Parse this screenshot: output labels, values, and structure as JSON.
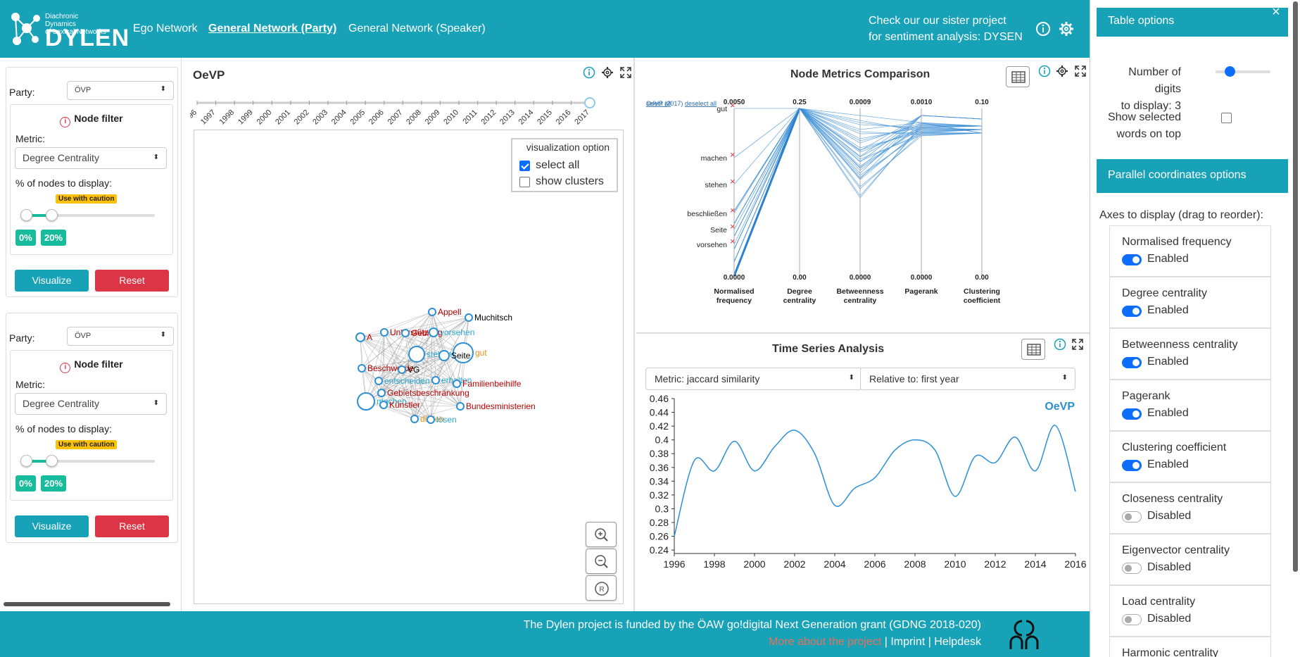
{
  "header": {
    "logo_subtitle_1": "Diachronic Dynamics",
    "logo_subtitle_2": "of Lexical Networks",
    "logo_text": "DYLEN",
    "nav": [
      "Ego Network",
      "General Network (Party)",
      "General Network (Speaker)"
    ],
    "nav_active": "General Network (Party)",
    "sister_line1": "Check our our sister project",
    "sister_line2": "for sentiment analysis: DYSEN",
    "icons": [
      "info-icon",
      "gear-icon"
    ]
  },
  "left_panels": [
    {
      "party_label": "Party:",
      "party_value": "ÖVP",
      "node_filter_title": "Node filter",
      "metric_label": "Metric:",
      "metric_value": "Degree Centrality",
      "percent_label": "% of nodes to display:",
      "caution": "Use with caution",
      "range_min": "0%",
      "range_max": "20%",
      "visualize": "Visualize",
      "reset": "Reset"
    },
    {
      "party_label": "Party:",
      "party_value": "ÖVP",
      "node_filter_title": "Node filter",
      "metric_label": "Metric:",
      "metric_value": "Degree Centrality",
      "percent_label": "% of nodes to display:",
      "caution": "Use with caution",
      "range_min": "0%",
      "range_max": "20%",
      "visualize": "Visualize",
      "reset": "Reset"
    }
  ],
  "network": {
    "title": "OeVP",
    "years": [
      "1996",
      "1997",
      "1998",
      "1999",
      "2000",
      "2001",
      "2002",
      "2003",
      "2004",
      "2005",
      "2006",
      "2007",
      "2008",
      "2009",
      "2010",
      "2011",
      "2012",
      "2013",
      "2014",
      "2015",
      "2016",
      "2017"
    ],
    "selected_year": "2017",
    "vis_option_title": "visualization option",
    "select_all": "select all",
    "show_clusters": "show clusters",
    "select_all_checked": true,
    "show_clusters_checked": false,
    "node_labels": [
      {
        "text": "Appell",
        "color": "#b00"
      },
      {
        "text": "Muchitsch",
        "color": "#000"
      },
      {
        "text": "A",
        "color": "#b00"
      },
      {
        "text": "Unterstützung",
        "color": "#b00"
      },
      {
        "text": "Gebiet",
        "color": "#b00"
      },
      {
        "text": "vorsehen",
        "color": "#29a8d0"
      },
      {
        "text": "gut",
        "color": "#e8901a"
      },
      {
        "text": "Beschwerde",
        "color": "#b00"
      },
      {
        "text": "VG",
        "color": "#000"
      },
      {
        "text": "stehen",
        "color": "#29a8d0"
      },
      {
        "text": "entscheiden",
        "color": "#29a8d0"
      },
      {
        "text": "Seite",
        "color": "#000"
      },
      {
        "text": "erhalten",
        "color": "#29a8d0"
      },
      {
        "text": "Familienbeihilfe",
        "color": "#b00"
      },
      {
        "text": "Gebietsbeschränkung",
        "color": "#b00"
      },
      {
        "text": "machen",
        "color": "#29a8d0"
      },
      {
        "text": "Künstler",
        "color": "#b00"
      },
      {
        "text": "Bundesministerien",
        "color": "#b00"
      },
      {
        "text": "dürfen",
        "color": "#e8901a"
      },
      {
        "text": "lösen",
        "color": "#29a8d0"
      }
    ],
    "zoom_in": "zoom-in-icon",
    "zoom_out": "zoom-out-icon",
    "reset_zoom": "reset-icon"
  },
  "node_metrics": {
    "title": "Node Metrics Comparison",
    "subset_label": "OeVP (2017)",
    "select_all": "select all",
    "deselect_all": "deselect all",
    "words": [
      "gut",
      "machen",
      "stehen",
      "beschließen",
      "Seite",
      "vorsehen"
    ],
    "axes": [
      {
        "name_1": "Normalised",
        "name_2": "frequency",
        "max": "0.0050",
        "min": "0.0000"
      },
      {
        "name_1": "Degree",
        "name_2": "centrality",
        "max": "0.25",
        "min": "0.00"
      },
      {
        "name_1": "Betweenness",
        "name_2": "centrality",
        "max": "0.0009",
        "min": "0.0000"
      },
      {
        "name_1": "Pagerank",
        "name_2": "",
        "max": "0.0010",
        "min": "0.0000"
      },
      {
        "name_1": "Clustering",
        "name_2": "coefficient",
        "max": "0.10",
        "min": "0.00"
      }
    ]
  },
  "time_series": {
    "title": "Time Series Analysis",
    "metric_select": "Metric: jaccard similarity",
    "relative_select": "Relative to: first year",
    "series_label": "OeVP",
    "chart_data": {
      "type": "line",
      "x": [
        1996,
        1997,
        1998,
        1999,
        2000,
        2001,
        2002,
        2003,
        2004,
        2005,
        2006,
        2007,
        2008,
        2009,
        2010,
        2011,
        2012,
        2013,
        2014,
        2015,
        2016
      ],
      "values": [
        0.26,
        0.37,
        0.355,
        0.398,
        0.355,
        0.39,
        0.414,
        0.38,
        0.305,
        0.33,
        0.345,
        0.385,
        0.4,
        0.385,
        0.318,
        0.376,
        0.367,
        0.404,
        0.355,
        0.421,
        0.325
      ],
      "xticks": [
        "1996",
        "1998",
        "2000",
        "2002",
        "2004",
        "2006",
        "2008",
        "2010",
        "2012",
        "2014",
        "2016"
      ],
      "yticks": [
        "0.46",
        "0.44",
        "0.42",
        "0.4",
        "0.38",
        "0.36",
        "0.34",
        "0.32",
        "0.3",
        "0.28",
        "0.26",
        "0.24"
      ],
      "ylim": [
        0.235,
        0.46
      ],
      "xlim": [
        1996,
        2016
      ],
      "color": "#2b8fd6"
    }
  },
  "footer": {
    "line1": "The Dylen project is funded by the ÖAW go!digital Next Generation grant (GDNG 2018-020)",
    "more": "More about the project",
    "imprint": "Imprint",
    "helpdesk": "Helpdesk",
    "sep": "|"
  },
  "right_panel": {
    "close": "×",
    "table_options_title": "Table options",
    "digits_label_1": "Number of digits",
    "digits_label_2": "to display: 3",
    "show_selected_1": "Show selected",
    "show_selected_2": "words on top",
    "parallel_title": "Parallel coordinates options",
    "axes_label": "Axes to display (drag to reorder):",
    "axes": [
      {
        "name": "Normalised frequency",
        "status": "Enabled",
        "on": true
      },
      {
        "name": "Degree centrality",
        "status": "Enabled",
        "on": true
      },
      {
        "name": "Betweenness centrality",
        "status": "Enabled",
        "on": true
      },
      {
        "name": "Pagerank",
        "status": "Enabled",
        "on": true
      },
      {
        "name": "Clustering coefficient",
        "status": "Enabled",
        "on": true
      },
      {
        "name": "Closeness centrality",
        "status": "Disabled",
        "on": false
      },
      {
        "name": "Eigenvector centrality",
        "status": "Disabled",
        "on": false
      },
      {
        "name": "Load centrality",
        "status": "Disabled",
        "on": false
      },
      {
        "name": "Harmonic centrality",
        "status": "",
        "on": false
      }
    ]
  },
  "colors": {
    "accent": "#17a2b8",
    "danger": "#dc3545",
    "success": "#18bc9c",
    "caution": "#ffc107",
    "primary": "#0d6efd"
  }
}
